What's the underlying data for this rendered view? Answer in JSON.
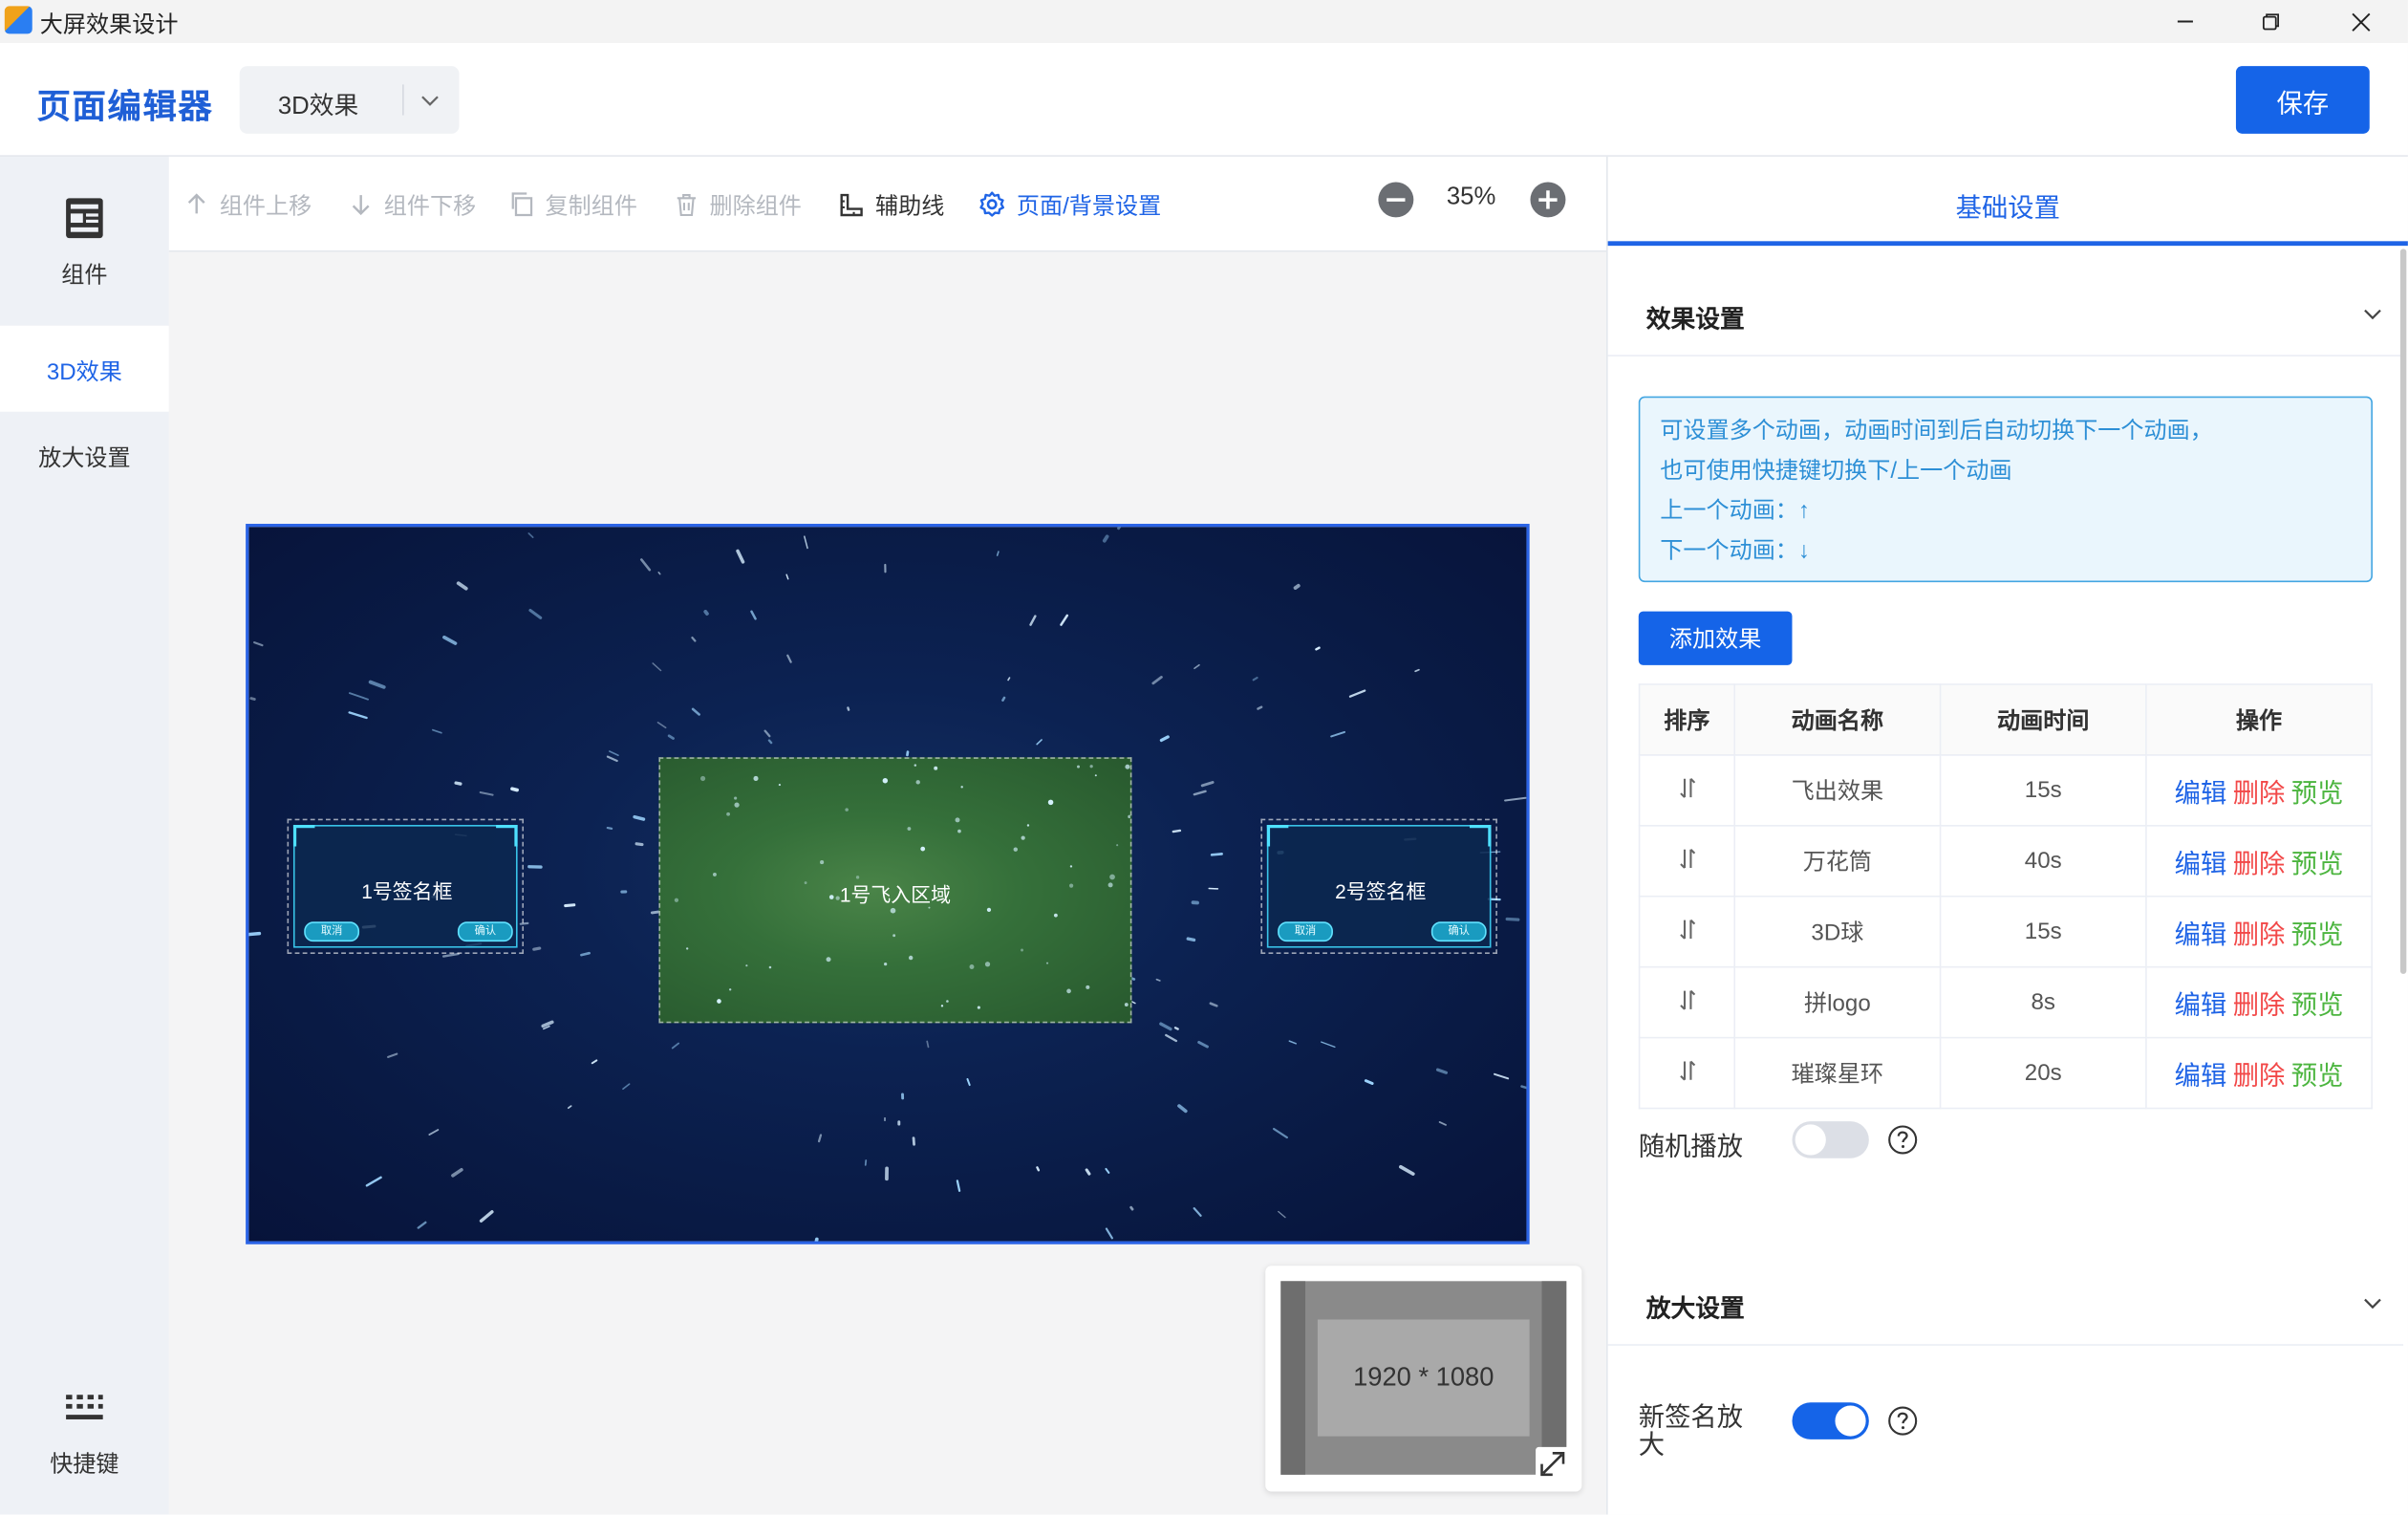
{
  "window": {
    "title": "大屏效果设计"
  },
  "header": {
    "brand": "页面编辑器",
    "effect_select": "3D效果",
    "save_label": "保存"
  },
  "leftnav": {
    "components": "组件",
    "effect_3d": "3D效果",
    "zoom_settings": "放大设置",
    "shortcuts": "快捷键"
  },
  "toolbar": {
    "move_up": "组件上移",
    "move_down": "组件下移",
    "copy": "复制组件",
    "delete": "删除组件",
    "guides": "辅助线",
    "page_settings": "页面/背景设置",
    "zoom": "35%"
  },
  "canvas": {
    "sign_frame_1": "1号签名框",
    "sign_frame_2": "2号签名框",
    "fly_in_area": "1号飞入区域",
    "cancel_btn": "取消",
    "confirm_btn": "确认",
    "minimap_size": "1920 * 1080"
  },
  "panel": {
    "tab": "基础设置",
    "effect_section": "效果设置",
    "tips": [
      "可设置多个动画，动画时间到后自动切换下一个动画，",
      "也可使用快捷键切换下/上一个动画",
      "上一个动画：↑",
      "下一个动画：↓"
    ],
    "add_effect": "添加效果",
    "table_headers": [
      "排序",
      "动画名称",
      "动画时间",
      "操作"
    ],
    "rows": [
      {
        "name": "飞出效果",
        "time": "15s"
      },
      {
        "name": "万花筒",
        "time": "40s"
      },
      {
        "name": "3D球",
        "time": "15s"
      },
      {
        "name": "拼logo",
        "time": "8s"
      },
      {
        "name": "璀璨星环",
        "time": "20s"
      }
    ],
    "op_edit": "编辑",
    "op_delete": "删除",
    "op_preview": "预览",
    "random_play": "随机播放",
    "random_play_on": false,
    "zoom_section": "放大设置",
    "new_sign_zoom": "新签名放大",
    "new_sign_zoom_on": true
  },
  "colors": {
    "primary": "#1564e8",
    "delete": "#f24848",
    "preview": "#4cb53f",
    "tip_text": "#2d8fd6"
  }
}
